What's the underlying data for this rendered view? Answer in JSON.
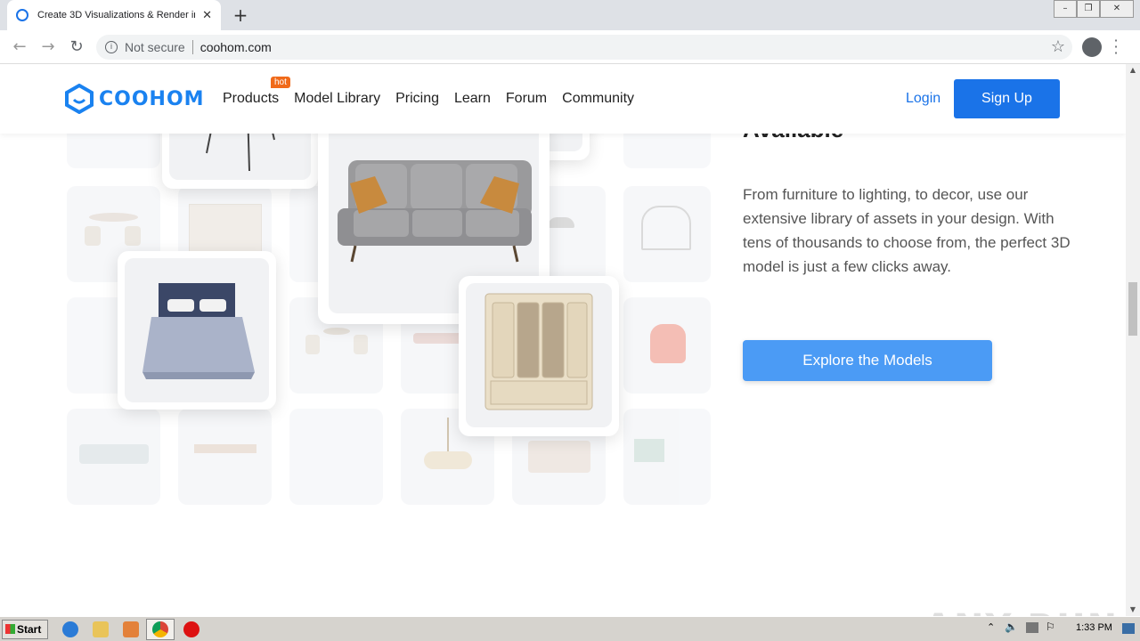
{
  "browser": {
    "tab_title": "Create 3D Visualizations & Render in",
    "tab_close": "✕",
    "new_tab": "+",
    "security_label": "Not secure",
    "url": "coohom.com"
  },
  "header": {
    "logo_text": "COOHOM",
    "nav": [
      {
        "label": "Products"
      },
      {
        "label": "Model Library"
      },
      {
        "label": "Pricing"
      },
      {
        "label": "Learn"
      },
      {
        "label": "Forum"
      },
      {
        "label": "Community"
      }
    ],
    "hot_badge": "hot",
    "login": "Login",
    "signup": "Sign Up"
  },
  "main": {
    "headline_fragment": "Available",
    "description": "From furniture to lighting, to decor, use our extensive library of assets in your design. With tens of thousands to choose from, the perfect 3D model is just a few clicks away.",
    "cta": "Explore the Models"
  },
  "watermark": "ANY RUN",
  "taskbar": {
    "start": "Start",
    "clock": "1:33 PM"
  },
  "colors": {
    "brand": "#1a82f0",
    "signup_bg": "#1a73e8",
    "cta_bg": "#4b9bf5",
    "hot": "#f06a1a"
  }
}
